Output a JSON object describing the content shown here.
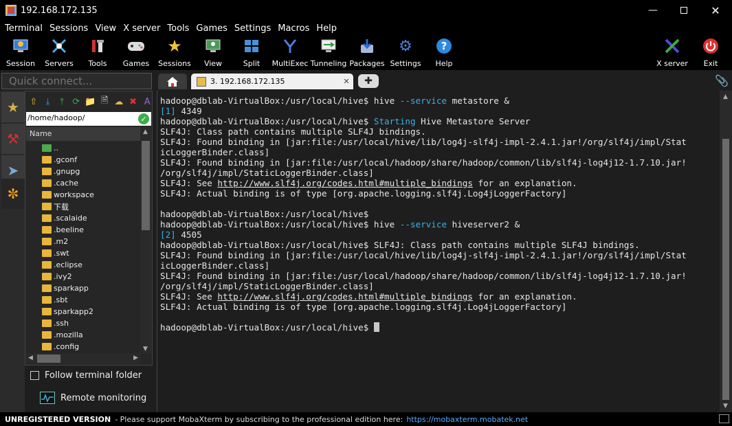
{
  "window": {
    "title": "192.168.172.135"
  },
  "menu": [
    "Terminal",
    "Sessions",
    "View",
    "X server",
    "Tools",
    "Games",
    "Settings",
    "Macros",
    "Help"
  ],
  "toolbar": {
    "left": [
      {
        "label": "Session",
        "icon": "session-icon"
      },
      {
        "label": "Servers",
        "icon": "servers-icon"
      },
      {
        "label": "Tools",
        "icon": "tools-icon"
      },
      {
        "label": "Games",
        "icon": "games-icon"
      },
      {
        "label": "Sessions",
        "icon": "star-icon"
      },
      {
        "label": "View",
        "icon": "view-icon"
      },
      {
        "label": "Split",
        "icon": "split-icon"
      },
      {
        "label": "MultiExec",
        "icon": "multiexec-icon"
      },
      {
        "label": "Tunneling",
        "icon": "tunneling-icon"
      },
      {
        "label": "Packages",
        "icon": "packages-icon"
      },
      {
        "label": "Settings",
        "icon": "gear-icon"
      },
      {
        "label": "Help",
        "icon": "help-icon"
      }
    ],
    "right": [
      {
        "label": "X server",
        "icon": "x-icon"
      },
      {
        "label": "Exit",
        "icon": "power-icon"
      }
    ]
  },
  "quick_connect": {
    "placeholder": "Quick connect..."
  },
  "tabs": {
    "session_label": "3. 192.168.172.135"
  },
  "file_browser": {
    "path": "/home/hadoop/",
    "column_header": "Name",
    "items": [
      "..",
      ".gconf",
      ".gnupg",
      ".cache",
      "workspace",
      "下载",
      ".scalaide",
      ".beeline",
      ".m2",
      ".swt",
      ".eclipse",
      ".ivy2",
      "sparkapp",
      ".sbt",
      "sparkapp2",
      ".ssh",
      ".mozilla",
      ".config"
    ]
  },
  "follow_label": "Follow terminal folder",
  "monitor_label": "Remote monitoring",
  "terminal": {
    "lines": [
      [
        {
          "t": "hadoop@dblab-VirtualBox:/usr/local/hive$ hive "
        },
        {
          "t": "--service",
          "c": "blue"
        },
        {
          "t": " metastore &"
        }
      ],
      [
        {
          "t": "[1]",
          "c": "blue"
        },
        {
          "t": " 4349"
        }
      ],
      [
        {
          "t": "hadoop@dblab-VirtualBox:/usr/local/hive$ "
        },
        {
          "t": "Starting",
          "c": "blue"
        },
        {
          "t": " Hive Metastore Server"
        }
      ],
      [
        {
          "t": "SLF4J: Class path contains multiple SLF4J bindings."
        }
      ],
      [
        {
          "t": "SLF4J: Found binding in [jar:file:/usr/local/hive/lib/log4j-slf4j-impl-2.4.1.jar!/org/slf4j/impl/Stat"
        }
      ],
      [
        {
          "t": "icLoggerBinder.class]"
        }
      ],
      [
        {
          "t": "SLF4J: Found binding in [jar:file:/usr/local/hadoop/share/hadoop/common/lib/slf4j-log4j12-1.7.10.jar!"
        }
      ],
      [
        {
          "t": "/org/slf4j/impl/StaticLoggerBinder.class]"
        }
      ],
      [
        {
          "t": "SLF4J: See "
        },
        {
          "t": "http://www.slf4j.org/codes.html#multiple_bindings",
          "u": true
        },
        {
          "t": " for an explanation."
        }
      ],
      [
        {
          "t": "SLF4J: Actual binding is of type [org.apache.logging.slf4j.Log4jLoggerFactory]"
        }
      ],
      [
        {
          "t": ""
        }
      ],
      [
        {
          "t": "hadoop@dblab-VirtualBox:/usr/local/hive$"
        }
      ],
      [
        {
          "t": "hadoop@dblab-VirtualBox:/usr/local/hive$ hive "
        },
        {
          "t": "--service",
          "c": "blue"
        },
        {
          "t": " hiveserver2 &"
        }
      ],
      [
        {
          "t": "[2]",
          "c": "blue"
        },
        {
          "t": " 4505"
        }
      ],
      [
        {
          "t": "hadoop@dblab-VirtualBox:/usr/local/hive$ SLF4J: Class path contains multiple SLF4J bindings."
        }
      ],
      [
        {
          "t": "SLF4J: Found binding in [jar:file:/usr/local/hive/lib/log4j-slf4j-impl-2.4.1.jar!/org/slf4j/impl/Stat"
        }
      ],
      [
        {
          "t": "icLoggerBinder.class]"
        }
      ],
      [
        {
          "t": "SLF4J: Found binding in [jar:file:/usr/local/hadoop/share/hadoop/common/lib/slf4j-log4j12-1.7.10.jar!"
        }
      ],
      [
        {
          "t": "/org/slf4j/impl/StaticLoggerBinder.class]"
        }
      ],
      [
        {
          "t": "SLF4J: See "
        },
        {
          "t": "http://www.slf4j.org/codes.html#multiple_bindings",
          "u": true
        },
        {
          "t": " for an explanation."
        }
      ],
      [
        {
          "t": "SLF4J: Actual binding is of type [org.apache.logging.slf4j.Log4jLoggerFactory]"
        }
      ],
      [
        {
          "t": ""
        }
      ],
      [
        {
          "t": "hadoop@dblab-VirtualBox:/usr/local/hive$ "
        },
        {
          "cursor": true
        }
      ]
    ]
  },
  "status": {
    "unregistered": "UNREGISTERED VERSION",
    "message": "-  Please support MobaXterm by subscribing to the professional edition here:",
    "link": "https://mobaxterm.mobatek.net"
  },
  "colors": {
    "terminal_bg": "#1e1e1e",
    "accent_blue": "#3ab0e8"
  }
}
